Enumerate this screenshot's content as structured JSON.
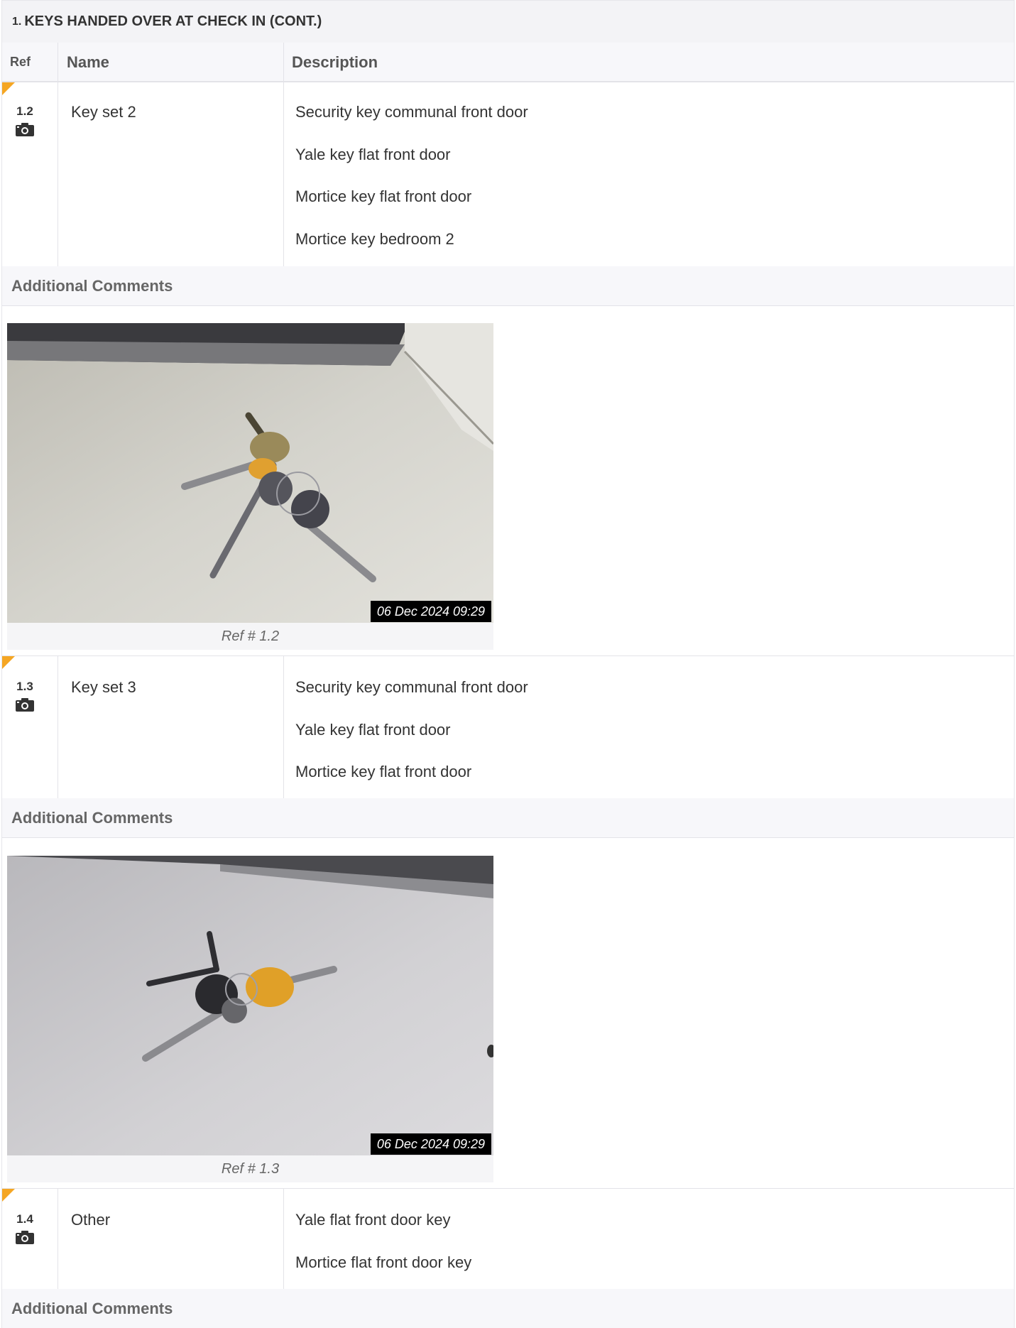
{
  "section": {
    "number": "1.",
    "title": "KEYS HANDED OVER AT CHECK IN (CONT.)"
  },
  "columns": {
    "ref": "Ref",
    "name": "Name",
    "description": "Description"
  },
  "rows": [
    {
      "ref": "1.2",
      "name": "Key set 2",
      "description": [
        "Security key communal front door",
        "Yale key flat front door",
        "Mortice key flat front door",
        "Mortice key bedroom 2"
      ],
      "comments_label": "Additional Comments",
      "photo": {
        "timestamp": "06 Dec 2024 09:29",
        "caption": "Ref # 1.2"
      }
    },
    {
      "ref": "1.3",
      "name": "Key set 3",
      "description": [
        "Security key communal front door",
        "Yale key flat front door",
        "Mortice key flat front door"
      ],
      "comments_label": "Additional Comments",
      "photo": {
        "timestamp": "06 Dec 2024 09:29",
        "caption": "Ref # 1.3"
      }
    },
    {
      "ref": "1.4",
      "name": "Other",
      "description": [
        "Yale flat front door key",
        "Mortice flat front door key"
      ],
      "comments_label": "Additional Comments"
    }
  ],
  "icons": {
    "camera": "camera-icon",
    "corner_flag": "corner-flag-icon"
  },
  "colors": {
    "accent": "#f5a623",
    "header_bg": "#f3f3f6"
  }
}
